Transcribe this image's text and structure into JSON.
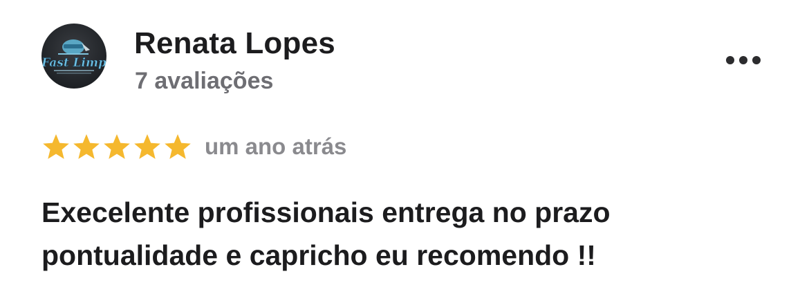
{
  "author": {
    "name": "Renata Lopes",
    "review_count": "7 avaliações",
    "avatar_logo_text": "Fast Limp"
  },
  "menu": {
    "icon": "more-horizontal-icon"
  },
  "rating": {
    "stars": 5,
    "max_stars": 5,
    "star_color": "#f5b82e",
    "time_ago": "um ano atrás"
  },
  "review": {
    "lines": [
      "Execelente profissionais entrega no prazo",
      "pontualidade e capricho eu recomendo !!"
    ]
  }
}
